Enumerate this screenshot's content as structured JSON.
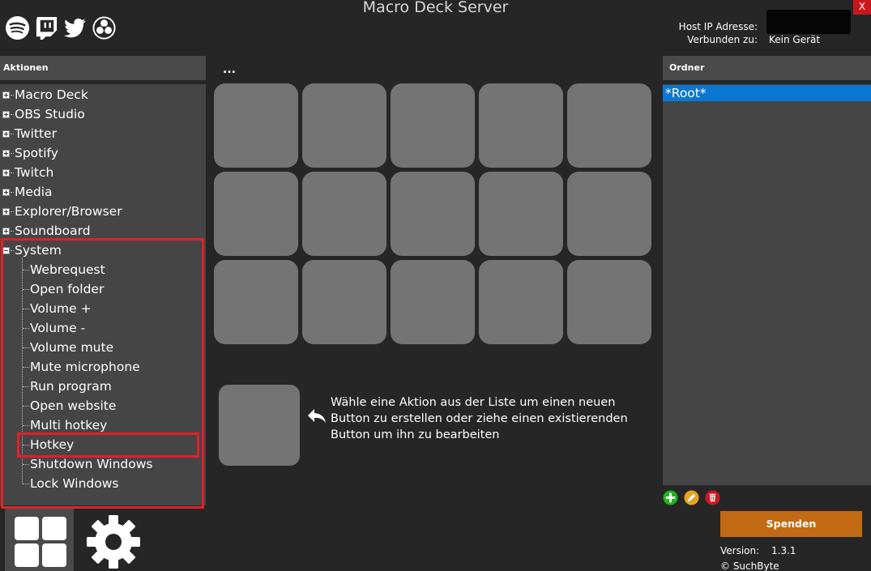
{
  "window": {
    "title": "Macro Deck Server",
    "close_label": "X"
  },
  "top_icons": [
    "spotify-icon",
    "twitch-icon",
    "twitter-icon",
    "obs-icon"
  ],
  "connection": {
    "host_ip_label": "Host IP Adresse:",
    "connected_label": "Verbunden zu:",
    "connected_value": "Kein Gerät"
  },
  "actions": {
    "header": "Aktionen",
    "categories": [
      {
        "label": "Macro Deck"
      },
      {
        "label": "OBS Studio"
      },
      {
        "label": "Twitter"
      },
      {
        "label": "Spotify"
      },
      {
        "label": "Twitch"
      },
      {
        "label": "Media"
      },
      {
        "label": "Explorer/Browser"
      },
      {
        "label": "Soundboard"
      },
      {
        "label": "System"
      }
    ],
    "system_children": [
      "Webrequest",
      "Open folder",
      "Volume +",
      "Volume -",
      "Volume mute",
      "Mute microphone",
      "Run program",
      "Open website",
      "Multi hotkey",
      "Hotkey",
      "Shutdown Windows",
      "Lock Windows"
    ]
  },
  "grid": {
    "menu_label": "...",
    "rows": 3,
    "columns": 5
  },
  "hint": {
    "line1": "Wähle eine Aktion aus der Liste um einen neuen",
    "line2": "Button zu erstellen oder ziehe einen existierenden",
    "line3": "Button um ihn zu bearbeiten"
  },
  "folders": {
    "header": "Ordner",
    "items": [
      "*Root*"
    ]
  },
  "folder_action_colors": {
    "add": "#1fb41f",
    "edit": "#e8a21c",
    "delete": "#d0161e"
  },
  "donate_label": "Spenden",
  "version": {
    "label": "Version:",
    "value": "1.3.1"
  },
  "copyright": "© SuchByte",
  "colors": {
    "accent": "#0a78d2",
    "donate": "#c26a14",
    "highlight": "#e0202a"
  }
}
